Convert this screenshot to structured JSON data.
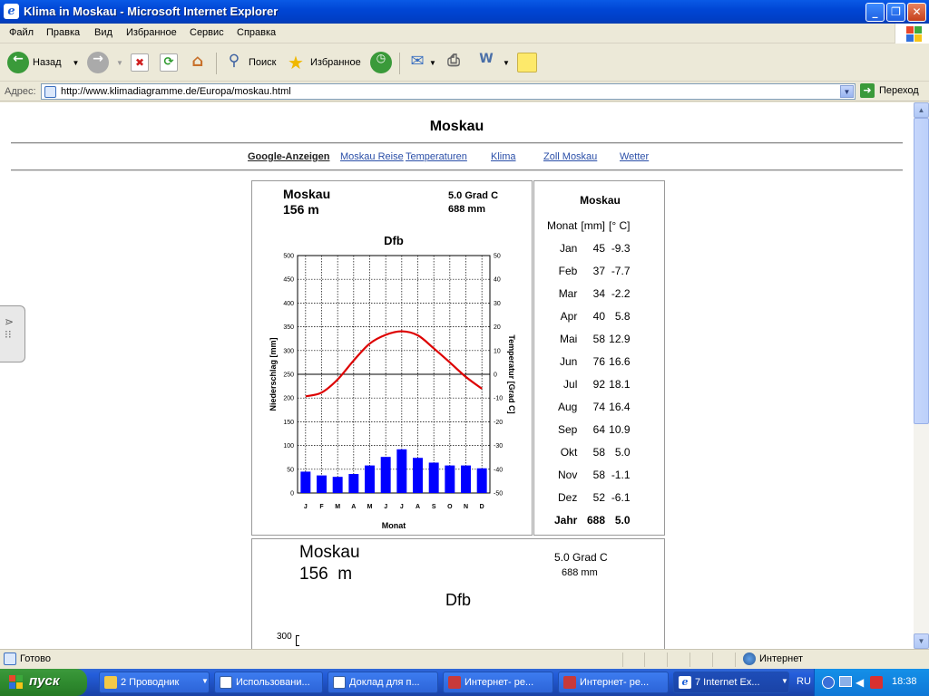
{
  "window": {
    "title": "Klima in Moskau - Microsoft Internet Explorer",
    "buttons": [
      "_",
      "❐",
      "✕"
    ]
  },
  "menu": [
    "Файл",
    "Правка",
    "Вид",
    "Избранное",
    "Сервис",
    "Справка"
  ],
  "toolbar": {
    "back": "Назад",
    "search": "Поиск",
    "favorites": "Избранное"
  },
  "address": {
    "label": "Адрес:",
    "url": "http://www.klimadiagramme.de/Europa/moskau.html",
    "go": "Переход"
  },
  "page": {
    "title": "Moskau",
    "ads_label": "Google-Anzeigen",
    "links": [
      "Moskau Reise",
      "Temperaturen",
      "Klima",
      "Zoll Moskau",
      "Wetter"
    ]
  },
  "chart_header": {
    "city": "Moskau",
    "elevation": "156 m",
    "temp": "5.0 Grad C",
    "precip": "688 mm",
    "climate": "Dfb"
  },
  "chart_data": {
    "type": "bar+line",
    "title": "Dfb",
    "categories": [
      "J",
      "F",
      "M",
      "A",
      "M",
      "J",
      "J",
      "A",
      "S",
      "O",
      "N",
      "D"
    ],
    "series": [
      {
        "name": "Niederschlag [mm]",
        "type": "bar",
        "axis": "left",
        "values": [
          45,
          37,
          34,
          40,
          58,
          76,
          92,
          74,
          64,
          58,
          58,
          52
        ]
      },
      {
        "name": "Temperatur [Grad C]",
        "type": "line",
        "axis": "right",
        "values": [
          -9.3,
          -7.7,
          -2.2,
          5.8,
          12.9,
          16.6,
          18.1,
          16.4,
          10.9,
          5.0,
          -1.1,
          -6.1
        ]
      }
    ],
    "xlabel": "Monat",
    "ylabel": "Niederschlag [mm]",
    "y2label": "Temperatur [Grad C]",
    "ylim": [
      0,
      500
    ],
    "y2lim": [
      -50,
      50
    ],
    "yticks": [
      0,
      50,
      100,
      150,
      200,
      250,
      300,
      350,
      400,
      450,
      500
    ],
    "y2ticks": [
      50,
      40,
      30,
      20,
      10,
      0,
      -10,
      -20,
      -30,
      -40,
      -50
    ],
    "grid": true
  },
  "table": {
    "title": "Moskau",
    "headers": [
      "Monat",
      "[mm]",
      "[° C]"
    ],
    "rows": [
      [
        "Jan",
        "45",
        "-9.3"
      ],
      [
        "Feb",
        "37",
        "-7.7"
      ],
      [
        "Mar",
        "34",
        "-2.2"
      ],
      [
        "Apr",
        "40",
        "5.8"
      ],
      [
        "Mai",
        "58",
        "12.9"
      ],
      [
        "Jun",
        "76",
        "16.6"
      ],
      [
        "Jul",
        "92",
        "18.1"
      ],
      [
        "Aug",
        "74",
        "16.4"
      ],
      [
        "Sep",
        "64",
        "10.9"
      ],
      [
        "Okt",
        "58",
        "5.0"
      ],
      [
        "Nov",
        "58",
        "-1.1"
      ],
      [
        "Dez",
        "52",
        "-6.1"
      ]
    ],
    "total": [
      "Jahr",
      "688",
      "5.0"
    ]
  },
  "chart2": {
    "city": "Moskau",
    "elevation": "156  m",
    "temp": "5.0 Grad C",
    "precip": "688 mm",
    "climate": "Dfb",
    "tick": "300"
  },
  "status": {
    "text": "Готово",
    "zone": "Интернет"
  },
  "taskbar": {
    "start": "пуск",
    "tasks": [
      "2 Проводник",
      "Использовани...",
      "Доклад для п...",
      "Интернет- ре...",
      "Интернет- ре...",
      "7 Internet Ex..."
    ],
    "lang": "RU",
    "clock": "18:38"
  },
  "colors": {
    "bars": "#0000ff",
    "line": "#dd0000",
    "link": "#2b4fa8"
  }
}
